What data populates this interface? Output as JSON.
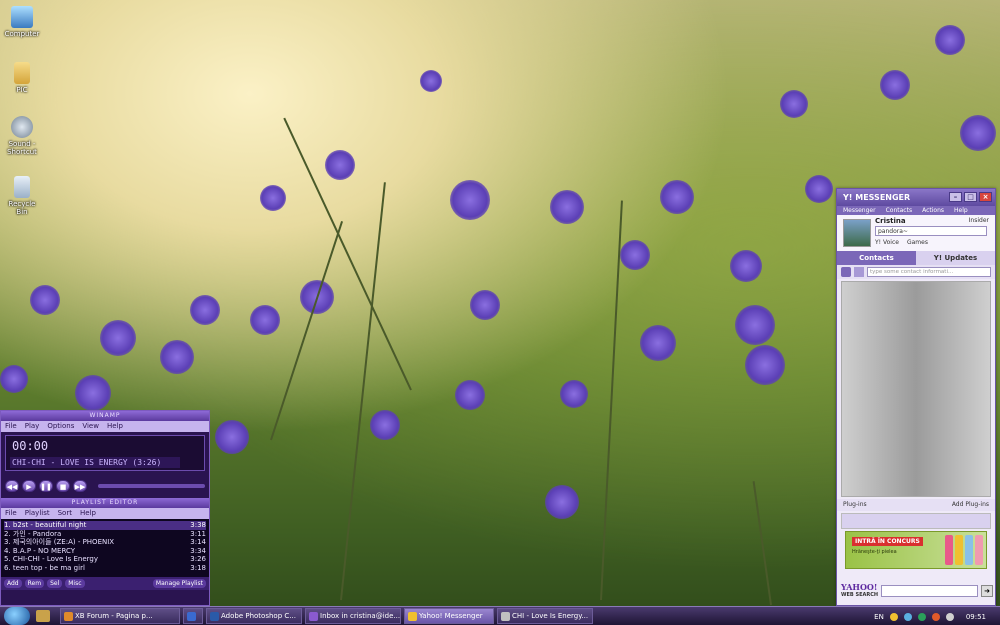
{
  "desktop": {
    "icons": [
      {
        "label": "Computer"
      },
      {
        "label": "PIC"
      },
      {
        "label": "Sound - Shortcut"
      },
      {
        "label": "Recycle Bin"
      }
    ]
  },
  "winamp": {
    "title": "WINAMP",
    "menu": [
      "File",
      "Play",
      "Options",
      "View",
      "Help"
    ],
    "time": "00:00",
    "track_display": "CHI-CHI - LOVE IS ENERGY (3:26)",
    "playlist_title": "PLAYLIST EDITOR",
    "playlist_menu": [
      "File",
      "Playlist",
      "Sort",
      "Help"
    ],
    "playlist": [
      {
        "title": "1. b2st - beautiful night",
        "time": "3:38"
      },
      {
        "title": "2. 가인 - Pandora",
        "time": "3:11"
      },
      {
        "title": "3. 제국의아이들 (ZE:A) - PHOENIX",
        "time": "3:14"
      },
      {
        "title": "4. B.A.P - NO MERCY",
        "time": "3:34"
      },
      {
        "title": "5. CHI-CHI - Love Is Energy",
        "time": "3:26"
      },
      {
        "title": "6. teen top - be ma girl",
        "time": "3:18"
      }
    ],
    "playlist_buttons": [
      "Add",
      "Rem",
      "Sel",
      "Misc",
      "Manage Playlist"
    ]
  },
  "messenger": {
    "title": "Y! MESSENGER",
    "menu": [
      "Messenger",
      "Contacts",
      "Actions",
      "Help"
    ],
    "profile_name": "Cristina",
    "insider": "Insider",
    "status": "pandora~",
    "voice": "Y! Voice",
    "games": "Games",
    "tab_contacts": "Contacts",
    "tab_updates": "Y! Updates",
    "search_placeholder": "type some contact informati...",
    "plugins_label": "Plug-ins",
    "add_plugins": "Add Plug-ins",
    "ad_title": "INTRĂ ÎN CONCURS",
    "ad_sub": "Hrăneşte-ţi pielea",
    "yahoo_logo": "YAHOO!",
    "yahoo_sub": "WEB SEARCH"
  },
  "taskbar": {
    "tasks": [
      {
        "label": "XB Forum - Pagina p...",
        "icon_color": "#e08a2a"
      },
      {
        "label": "",
        "icon_color": "#3a6ad0"
      },
      {
        "label": "Adobe Photoshop C...",
        "icon_color": "#2a5aa8"
      },
      {
        "label": "Inbox in cristina@ide...",
        "icon_color": "#8a5ad0"
      },
      {
        "label": "Yahoo! Messenger",
        "icon_color": "#f0c030"
      },
      {
        "label": "CHI - Love Is Energy...",
        "icon_color": "#c0c0c0"
      }
    ],
    "language": "EN",
    "clock": "09:51"
  }
}
